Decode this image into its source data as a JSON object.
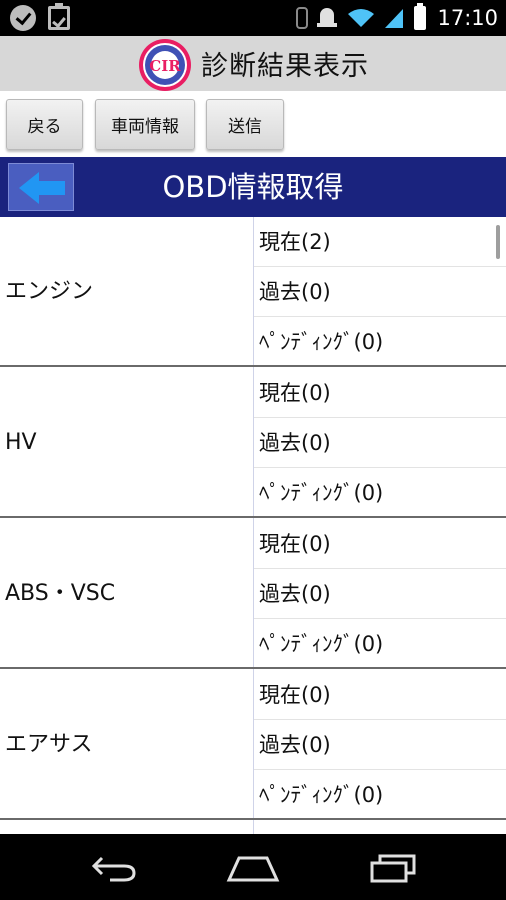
{
  "status_bar": {
    "time": "17:10",
    "icons": [
      "check-icon",
      "clipboard-icon",
      "bluetooth-icon",
      "alarm-icon",
      "wifi-icon",
      "signal-icon",
      "battery-icon"
    ]
  },
  "app": {
    "title": "診断結果表示",
    "logo_text": "CIR"
  },
  "toolbar": {
    "back_label": "戻る",
    "vehicle_info_label": "車両情報",
    "send_label": "送信"
  },
  "section": {
    "title": "OBD情報取得"
  },
  "groups": [
    {
      "label": "エンジン",
      "items": [
        "現在(2)",
        "過去(0)",
        "ﾍﾟﾝﾃﾞｨﾝｸﾞ(0)"
      ]
    },
    {
      "label": "HV",
      "items": [
        "現在(0)",
        "過去(0)",
        "ﾍﾟﾝﾃﾞｨﾝｸﾞ(0)"
      ]
    },
    {
      "label": "ABS・VSC",
      "items": [
        "現在(0)",
        "過去(0)",
        "ﾍﾟﾝﾃﾞｨﾝｸﾞ(0)"
      ]
    },
    {
      "label": "エアサス",
      "items": [
        "現在(0)",
        "過去(0)",
        "ﾍﾟﾝﾃﾞｨﾝｸﾞ(0)"
      ]
    }
  ],
  "colors": {
    "header_blue": "#1a237e",
    "arrow_blue": "#2196f3",
    "title_bar_gray": "#d7d7d7"
  }
}
